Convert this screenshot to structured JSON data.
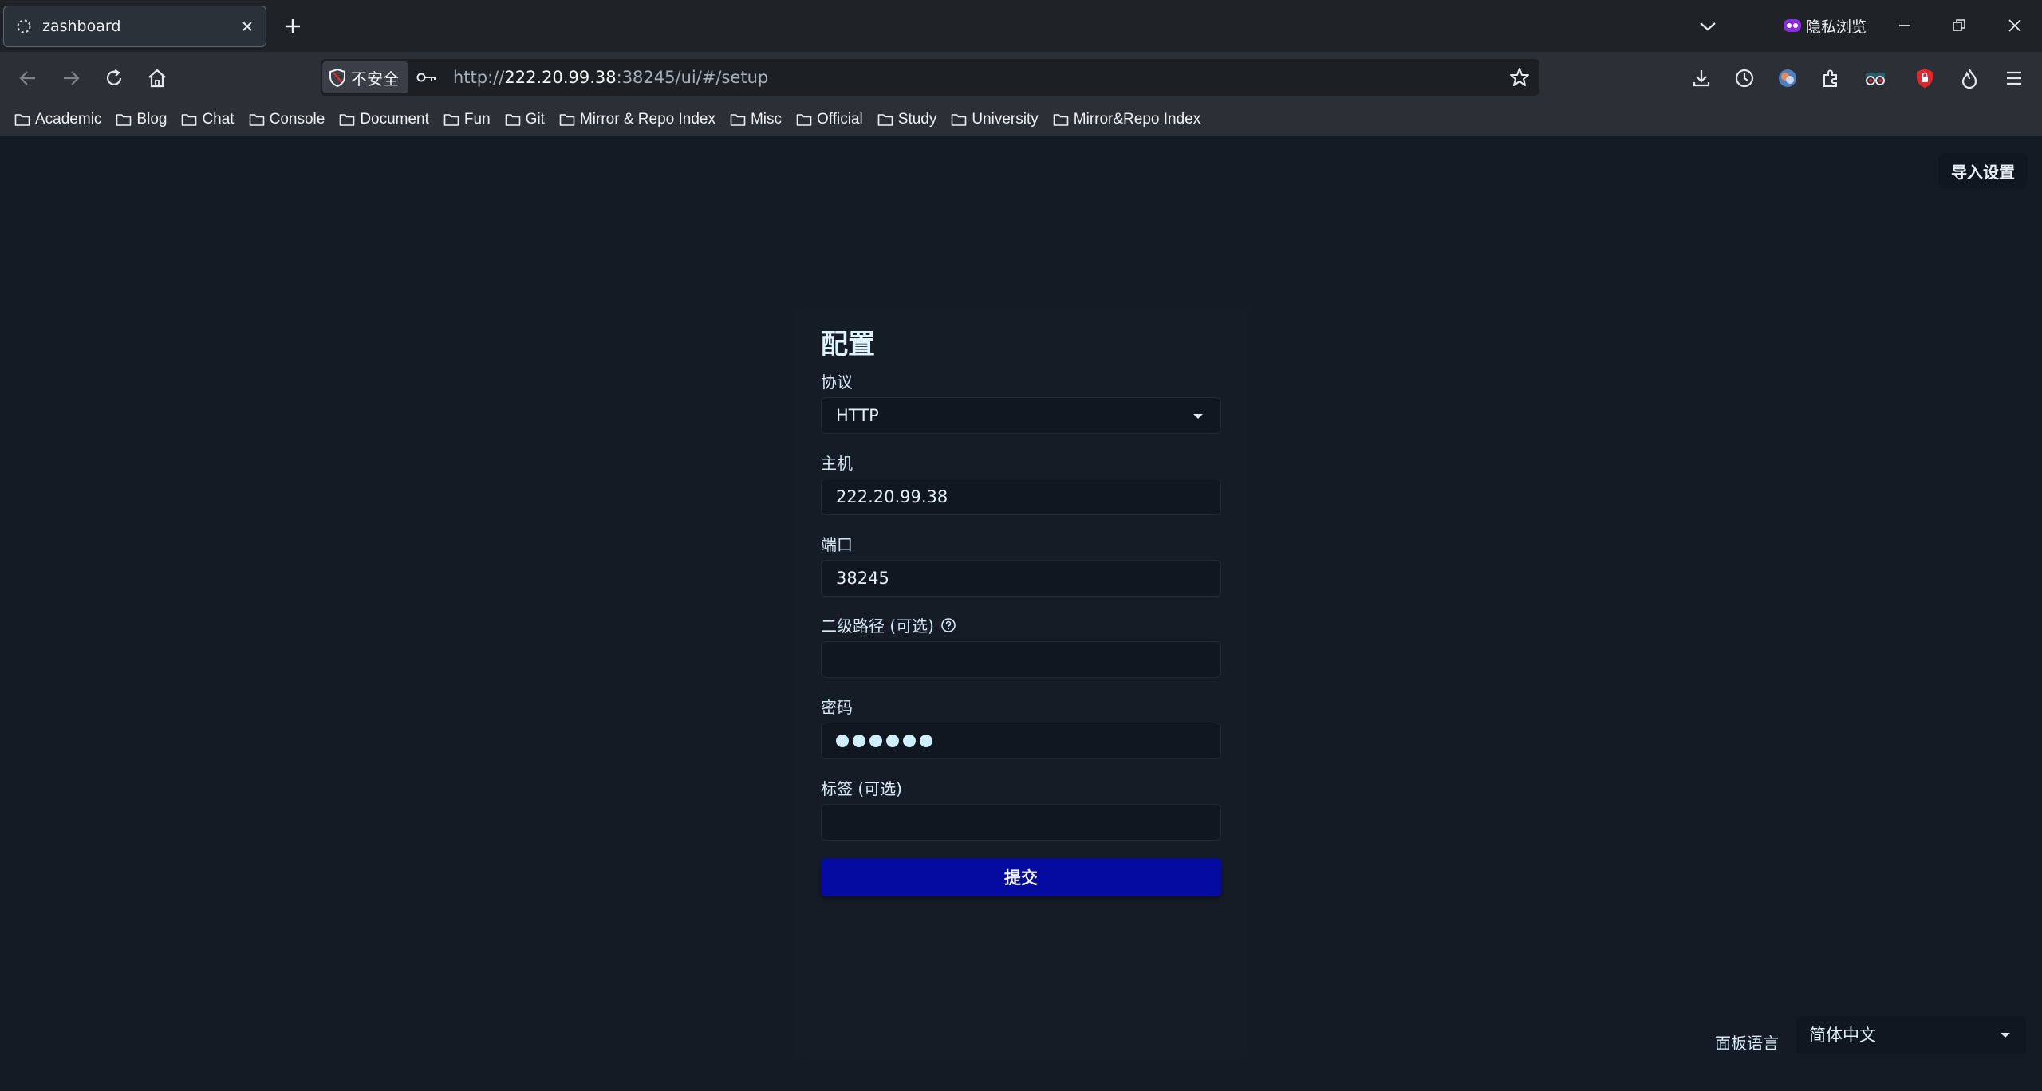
{
  "colors": {
    "page_bg": "#151b24",
    "card_bg": "#161c26",
    "input_bg": "#111720",
    "accent_button": "#050ba0",
    "text_light": "#dff3ff",
    "privacy_badge": "#8a2be2",
    "shield_red": "#e0262a"
  },
  "tab": {
    "title": "zashboard",
    "favicon": "loading-dashed-circle-icon"
  },
  "private_browsing": {
    "label": "隐私浏览",
    "icon": "mask-icon"
  },
  "urlbar": {
    "security_label": "不安全",
    "url_scheme": "http://",
    "url_host": "222.20.99.38",
    "url_rest": ":38245/ui/#/setup"
  },
  "toolbar": {
    "icons": [
      "download-icon",
      "history-icon",
      "profile-avatar-icon",
      "extensions-icon",
      "spy-extension-icon",
      "shield-extension-icon",
      "flame-icon",
      "menu-icon"
    ]
  },
  "bookmarks": [
    {
      "label": "Academic"
    },
    {
      "label": "Blog"
    },
    {
      "label": "Chat"
    },
    {
      "label": "Console"
    },
    {
      "label": "Document"
    },
    {
      "label": "Fun"
    },
    {
      "label": "Git"
    },
    {
      "label": "Mirror & Repo Index"
    },
    {
      "label": "Misc"
    },
    {
      "label": "Official"
    },
    {
      "label": "Study"
    },
    {
      "label": "University"
    },
    {
      "label": "Mirror&Repo Index"
    }
  ],
  "page": {
    "import_button": "导入设置",
    "title": "配置",
    "protocol_label": "协议",
    "protocol_value": "HTTP",
    "host_label": "主机",
    "host_value": "222.20.99.38",
    "port_label": "端口",
    "port_value": "38245",
    "path_label": "二级路径 (可选)",
    "path_value": "",
    "password_label": "密码",
    "password_length": 6,
    "tag_label": "标签 (可选)",
    "tag_value": "",
    "submit_label": "提交",
    "lang_label": "面板语言",
    "lang_value": "简体中文"
  }
}
